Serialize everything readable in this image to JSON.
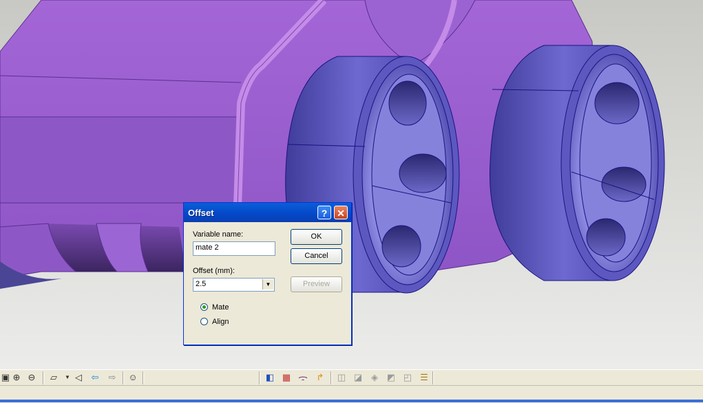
{
  "dialog": {
    "title": "Offset",
    "help_label": "?",
    "close_label": "✕",
    "variable_name_label": "Variable name:",
    "variable_name_value": "mate 2",
    "offset_label": "Offset (mm):",
    "offset_value": "2.5",
    "ok_label": "OK",
    "cancel_label": "Cancel",
    "preview_label": "Preview",
    "options": [
      {
        "label": "Mate",
        "selected": true
      },
      {
        "label": "Align",
        "selected": false
      }
    ]
  },
  "toolbar": {
    "left_icons": [
      "zoom-to-fit-icon",
      "zoom-in-icon",
      "zoom-out-icon",
      "view-orient-icon",
      "dropdown-arrow-icon",
      "previous-view-icon",
      "back-arrow-icon",
      "forward-arrow-icon",
      "smiley-icon"
    ],
    "right_icons": [
      "assembly-icon",
      "color-icon",
      "mate-icon",
      "pipe-icon",
      "part-icon",
      "cube-icon",
      "shading-icon",
      "wireframe-icon",
      "hidden-lines-icon",
      "layers-icon"
    ]
  },
  "colors": {
    "body": "#8d58c6",
    "wheel": "#6a67cc",
    "edge": "#1a1480",
    "dialog_title": "#0a5fd8"
  }
}
